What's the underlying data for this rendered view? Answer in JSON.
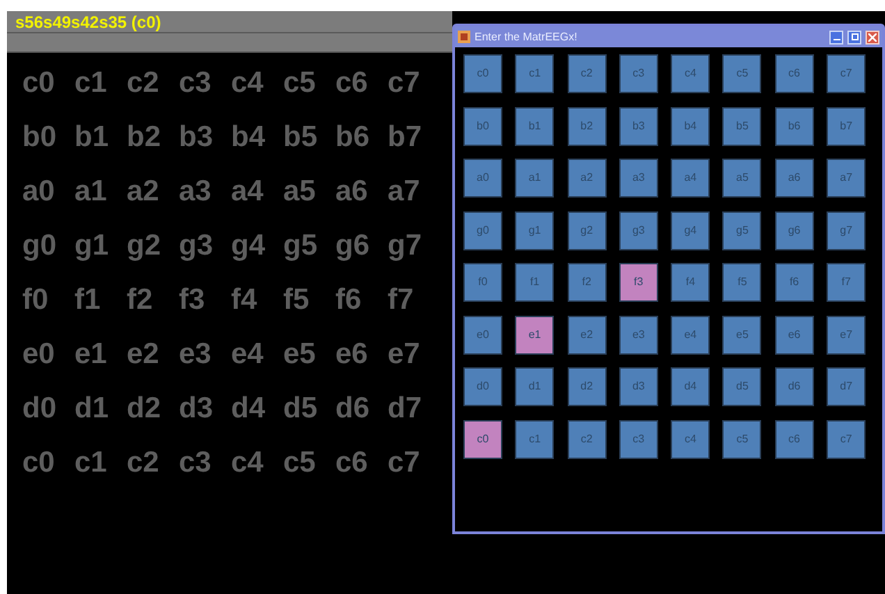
{
  "header": {
    "title": "s56s49s42s35 (c0)"
  },
  "letter_grid": {
    "rows": [
      [
        "c0",
        "c1",
        "c2",
        "c3",
        "c4",
        "c5",
        "c6",
        "c7"
      ],
      [
        "b0",
        "b1",
        "b2",
        "b3",
        "b4",
        "b5",
        "b6",
        "b7"
      ],
      [
        "a0",
        "a1",
        "a2",
        "a3",
        "a4",
        "a5",
        "a6",
        "a7"
      ],
      [
        "g0",
        "g1",
        "g2",
        "g3",
        "g4",
        "g5",
        "g6",
        "g7"
      ],
      [
        "f0",
        "f1",
        "f2",
        "f3",
        "f4",
        "f5",
        "f6",
        "f7"
      ],
      [
        "e0",
        "e1",
        "e2",
        "e3",
        "e4",
        "e5",
        "e6",
        "e7"
      ],
      [
        "d0",
        "d1",
        "d2",
        "d3",
        "d4",
        "d5",
        "d6",
        "d7"
      ],
      [
        "c0",
        "c1",
        "c2",
        "c3",
        "c4",
        "c5",
        "c6",
        "c7"
      ]
    ]
  },
  "window": {
    "title": "Enter the MatrEEGx!",
    "rows": [
      [
        {
          "label": "c0",
          "selected": false
        },
        {
          "label": "c1",
          "selected": false
        },
        {
          "label": "c2",
          "selected": false
        },
        {
          "label": "c3",
          "selected": false
        },
        {
          "label": "c4",
          "selected": false
        },
        {
          "label": "c5",
          "selected": false
        },
        {
          "label": "c6",
          "selected": false
        },
        {
          "label": "c7",
          "selected": false
        }
      ],
      [
        {
          "label": "b0",
          "selected": false
        },
        {
          "label": "b1",
          "selected": false
        },
        {
          "label": "b2",
          "selected": false
        },
        {
          "label": "b3",
          "selected": false
        },
        {
          "label": "b4",
          "selected": false
        },
        {
          "label": "b5",
          "selected": false
        },
        {
          "label": "b6",
          "selected": false
        },
        {
          "label": "b7",
          "selected": false
        }
      ],
      [
        {
          "label": "a0",
          "selected": false
        },
        {
          "label": "a1",
          "selected": false
        },
        {
          "label": "a2",
          "selected": false
        },
        {
          "label": "a3",
          "selected": false
        },
        {
          "label": "a4",
          "selected": false
        },
        {
          "label": "a5",
          "selected": false
        },
        {
          "label": "a6",
          "selected": false
        },
        {
          "label": "a7",
          "selected": false
        }
      ],
      [
        {
          "label": "g0",
          "selected": false
        },
        {
          "label": "g1",
          "selected": false
        },
        {
          "label": "g2",
          "selected": false
        },
        {
          "label": "g3",
          "selected": false
        },
        {
          "label": "g4",
          "selected": false
        },
        {
          "label": "g5",
          "selected": false
        },
        {
          "label": "g6",
          "selected": false
        },
        {
          "label": "g7",
          "selected": false
        }
      ],
      [
        {
          "label": "f0",
          "selected": false
        },
        {
          "label": "f1",
          "selected": false
        },
        {
          "label": "f2",
          "selected": false
        },
        {
          "label": "f3",
          "selected": true
        },
        {
          "label": "f4",
          "selected": false
        },
        {
          "label": "f5",
          "selected": false
        },
        {
          "label": "f6",
          "selected": false
        },
        {
          "label": "f7",
          "selected": false
        }
      ],
      [
        {
          "label": "e0",
          "selected": false
        },
        {
          "label": "e1",
          "selected": true
        },
        {
          "label": "e2",
          "selected": false
        },
        {
          "label": "e3",
          "selected": false
        },
        {
          "label": "e4",
          "selected": false
        },
        {
          "label": "e5",
          "selected": false
        },
        {
          "label": "e6",
          "selected": false
        },
        {
          "label": "e7",
          "selected": false
        }
      ],
      [
        {
          "label": "d0",
          "selected": false
        },
        {
          "label": "d1",
          "selected": false
        },
        {
          "label": "d2",
          "selected": false
        },
        {
          "label": "d3",
          "selected": false
        },
        {
          "label": "d4",
          "selected": false
        },
        {
          "label": "d5",
          "selected": false
        },
        {
          "label": "d6",
          "selected": false
        },
        {
          "label": "d7",
          "selected": false
        }
      ],
      [
        {
          "label": "c0",
          "selected": true
        },
        {
          "label": "c1",
          "selected": false
        },
        {
          "label": "c2",
          "selected": false
        },
        {
          "label": "c3",
          "selected": false
        },
        {
          "label": "c4",
          "selected": false
        },
        {
          "label": "c5",
          "selected": false
        },
        {
          "label": "c6",
          "selected": false
        },
        {
          "label": "c7",
          "selected": false
        }
      ]
    ]
  }
}
